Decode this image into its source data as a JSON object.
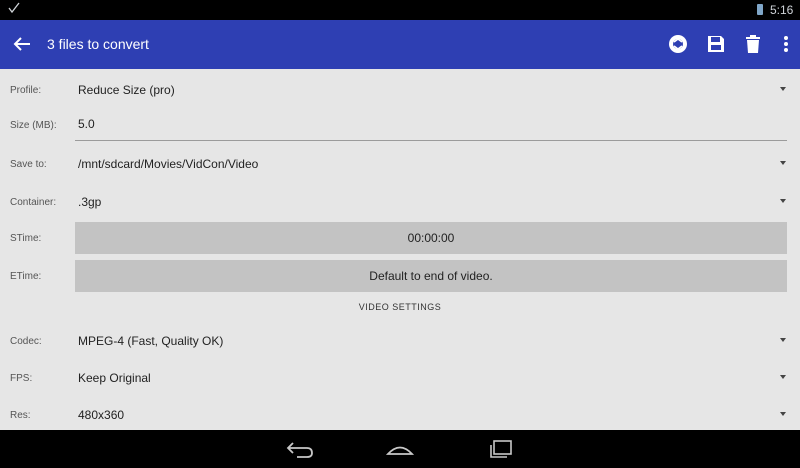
{
  "status_bar": {
    "check_icon": "check-icon",
    "time": "5:16"
  },
  "app_bar": {
    "title": "3 files to convert",
    "icons": [
      "back-arrow-icon",
      "convert-icon",
      "save-icon",
      "delete-icon",
      "more-vert-icon"
    ]
  },
  "form": {
    "profile": {
      "label": "Profile:",
      "value": "Reduce Size (pro)"
    },
    "size": {
      "label": "Size (MB):",
      "value": "5.0"
    },
    "save_to": {
      "label": "Save to:",
      "value": "/mnt/sdcard/Movies/VidCon/Video"
    },
    "container": {
      "label": "Container:",
      "value": ".3gp"
    },
    "stime": {
      "label": "STime:",
      "value": "00:00:00"
    },
    "etime": {
      "label": "ETime:",
      "value": "Default to end of video."
    },
    "video_settings_header": "VIDEO SETTINGS",
    "codec": {
      "label": "Codec:",
      "value": "MPEG-4 (Fast, Quality OK)"
    },
    "fps": {
      "label": "FPS:",
      "value": "Keep Original"
    },
    "res": {
      "label": "Res:",
      "value": "480x360"
    }
  },
  "nav_bar": {
    "icons": [
      "nav-back-icon",
      "nav-home-icon",
      "nav-recents-icon"
    ]
  }
}
